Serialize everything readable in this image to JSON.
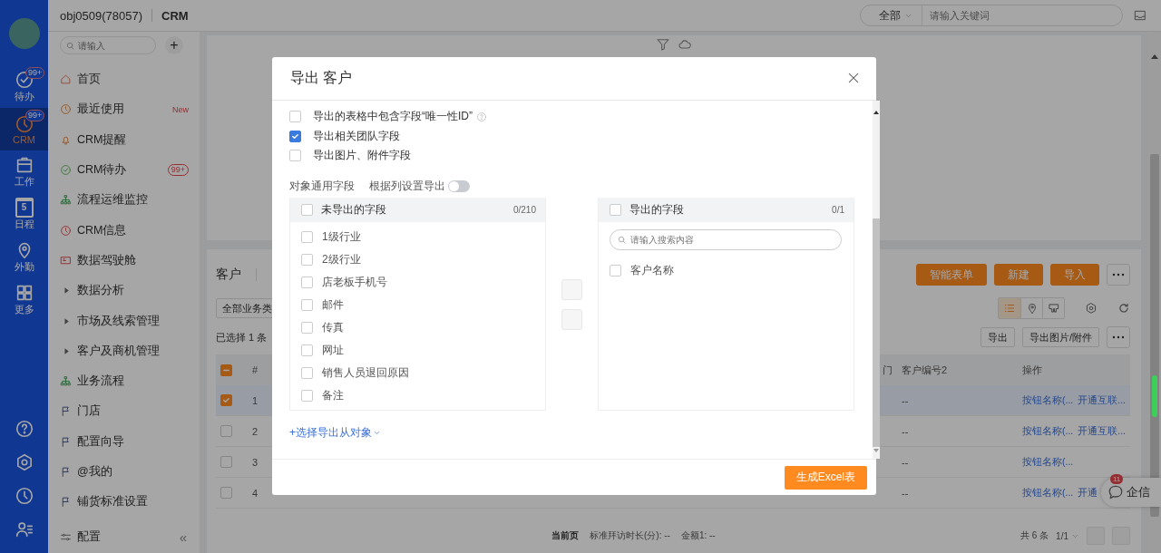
{
  "topbar": {
    "account": "obj0509(78057)",
    "app_name": "CRM",
    "search": {
      "scope": "全部",
      "placeholder": "请输入关键词"
    }
  },
  "rail": {
    "items": [
      {
        "label": "待办",
        "badge": "99+",
        "selected": false
      },
      {
        "label": "CRM",
        "badge": "99+",
        "selected": true
      },
      {
        "label": "工作",
        "selected": false
      },
      {
        "label": "日程",
        "day": "5",
        "selected": false
      },
      {
        "label": "外勤",
        "selected": false
      },
      {
        "label": "更多",
        "selected": false
      }
    ]
  },
  "sidebar": {
    "search": {
      "placeholder": "请输入"
    },
    "add_button": "+",
    "items": [
      {
        "kind": "link",
        "label": "首页"
      },
      {
        "kind": "link",
        "label": "最近使用",
        "tag": "New"
      },
      {
        "kind": "link",
        "label": "CRM提醒"
      },
      {
        "kind": "link",
        "label": "CRM待办",
        "badge": "99+"
      },
      {
        "kind": "link",
        "label": "流程运维监控"
      },
      {
        "kind": "link",
        "label": "CRM信息"
      },
      {
        "kind": "link",
        "label": "数据驾驶舱"
      },
      {
        "kind": "group",
        "label": "数据分析",
        "expanded": false
      },
      {
        "kind": "group",
        "label": "市场及线索管理",
        "expanded": false
      },
      {
        "kind": "group",
        "label": "客户及商机管理",
        "expanded": false
      },
      {
        "kind": "link",
        "label": "业务流程"
      },
      {
        "kind": "link",
        "label": "门店"
      },
      {
        "kind": "link",
        "label": "配置向导"
      },
      {
        "kind": "link",
        "label": "@我的"
      },
      {
        "kind": "link",
        "label": "铺货标准设置"
      }
    ],
    "footer": {
      "label": "配置",
      "collapse": "«"
    }
  },
  "list": {
    "tab": "客户",
    "buttons": [
      "智能表单",
      "新建",
      "导入"
    ],
    "filter": "全部业务类",
    "views": [
      {
        "selected": true
      },
      {
        "selected": false
      },
      {
        "selected": false
      }
    ],
    "selection_info": "已选择 1 条",
    "actions": [
      "导出",
      "导出图片/附件"
    ],
    "table": {
      "header_checkbox": {
        "indeterminate": true
      },
      "columns": [
        "#",
        "门",
        "客户编号2",
        "操作"
      ],
      "rows": [
        {
          "index": "1",
          "selected": true,
          "column_3": "--",
          "actions": [
            "按钮名称(...",
            "开通互联..."
          ]
        },
        {
          "index": "2",
          "selected": false,
          "column_3": "--",
          "actions": [
            "按钮名称(...",
            "开通互联..."
          ]
        },
        {
          "index": "3",
          "selected": false,
          "column_3": "--",
          "actions": [
            "按钮名称(..."
          ]
        },
        {
          "index": "4",
          "selected": false,
          "column_3": "--",
          "actions": [
            "按钮名称(...",
            "开通"
          ]
        }
      ]
    },
    "pager": {
      "current_label": "当前页",
      "summary": [
        "标准拜访时长(分): --",
        "金额1: --"
      ],
      "total": "共 6 条",
      "page": "1/1"
    }
  },
  "chat": {
    "label": "企信",
    "badge": "11"
  },
  "dialog": {
    "title": "导出 客户",
    "options": [
      {
        "label": "导出的表格中包含字段“唯一性ID”",
        "checked": false,
        "help": true
      },
      {
        "label": "导出相关团队字段",
        "checked": true
      },
      {
        "label": "导出图片、附件字段",
        "checked": false
      }
    ],
    "section": "对象通用字段",
    "column_toggle": {
      "label": "根据列设置导出",
      "on": false
    },
    "available": {
      "title": "未导出的字段",
      "count": "0/210",
      "checked": false,
      "items": [
        {
          "label": "1级行业",
          "checked": false
        },
        {
          "label": "2级行业",
          "checked": false
        },
        {
          "label": "店老板手机号",
          "checked": false
        },
        {
          "label": "邮件",
          "checked": false
        },
        {
          "label": "传真",
          "checked": false
        },
        {
          "label": "网址",
          "checked": false
        },
        {
          "label": "销售人员退回原因",
          "checked": false
        },
        {
          "label": "备注",
          "checked": false
        }
      ]
    },
    "transfer_buttons": [
      {
        "disabled": true
      },
      {
        "disabled": true
      }
    ],
    "selected": {
      "title": "导出的字段",
      "count": "0/1",
      "checked": false,
      "search_placeholder": "请输入搜索内容",
      "items": [
        {
          "label": "客户名称",
          "checked": false
        }
      ]
    },
    "link": "+选择导出从对象",
    "submit": "生成Excel表"
  }
}
